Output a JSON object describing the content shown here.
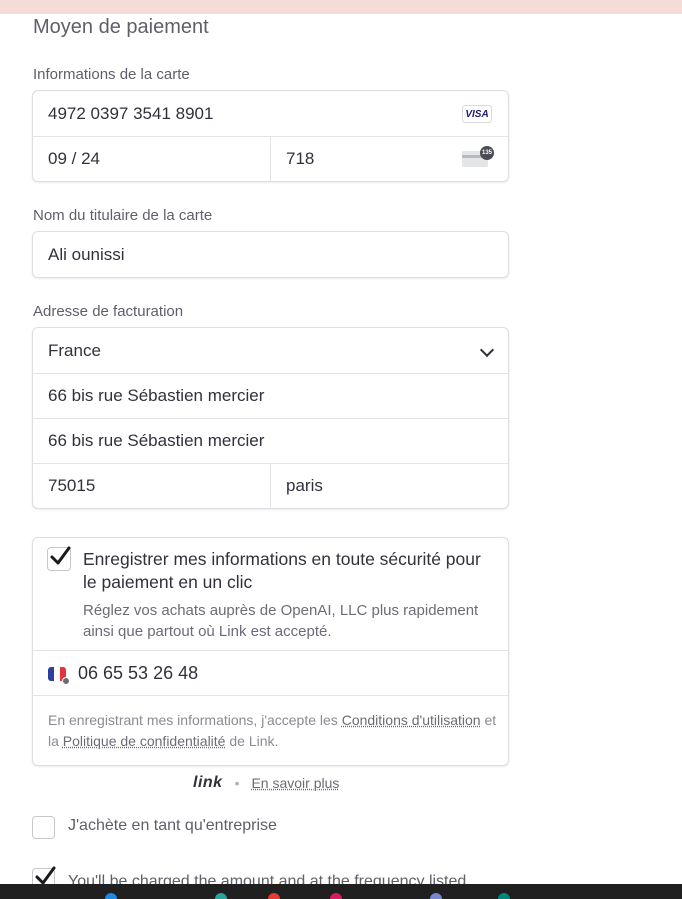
{
  "section_title": "Moyen de paiement",
  "card": {
    "label": "Informations de la carte",
    "number": "4972 0397 3541 8901",
    "brand": "VISA",
    "expiry": "09 / 24",
    "cvc": "718",
    "cvc_badge": "135"
  },
  "cardholder": {
    "label": "Nom du titulaire de la carte",
    "name": "Ali ounissi"
  },
  "billing": {
    "label": "Adresse de facturation",
    "country": "France",
    "line1": "66 bis rue Sébastien mercier",
    "line2": "66 bis rue Sébastien mercier",
    "postal_code": "75015",
    "city": "paris"
  },
  "link": {
    "save_title": "Enregistrer mes informations en toute sécurité pour le paiement en un clic",
    "save_desc": "Réglez vos achats auprès de OpenAI, LLC plus rapidement ainsi que partout où Link est accepté.",
    "save_checked": true,
    "phone": "06 65 53 26 48",
    "legal_prefix": "En enregistrant mes informations, j'accepte les ",
    "terms": "Conditions d'utilisation",
    "legal_mid": " et la ",
    "privacy": "Politique de confidentialité",
    "legal_suffix": " de Link.",
    "logo": "link",
    "separator": "•",
    "learn_more": "En savoir plus"
  },
  "business": {
    "label": "J'achète en tant qu'entreprise",
    "checked": false
  },
  "charge_notice": {
    "label": "You'll be charged the amount and at the frequency listed",
    "checked": true
  },
  "colors": {
    "top_strip": "#f6dcd6",
    "taskbar": "#202020",
    "text": "#30313d",
    "muted": "#6b6c76"
  }
}
